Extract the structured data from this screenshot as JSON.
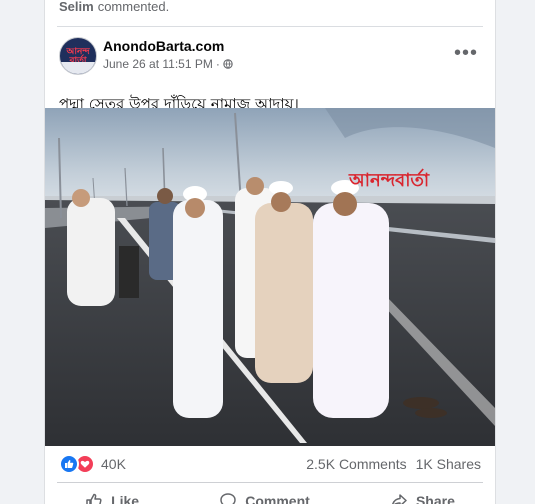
{
  "activity": {
    "actor": "Selim",
    "text": "commented."
  },
  "post": {
    "page_name": "AnondoBarta.com",
    "date": "June 26 at 11:51 PM",
    "separator": "·",
    "privacy_icon": "globe-icon",
    "more_icon": "more-horizontal-icon",
    "more_label": "•••",
    "text": "পদ্মা সেতুর উপর দাঁড়িয়ে নামাজ আদায়।",
    "avatar_text": "আনন্দ\nবার্তা",
    "photo": {
      "description": "Men in white clothing and caps praying on a bridge road",
      "watermark": "আনন্দবার্তা"
    }
  },
  "stats": {
    "reactions_count": "40K",
    "comments": "2.5K Comments",
    "shares": "1K Shares"
  },
  "actions": {
    "like": "Like",
    "comment": "Comment",
    "share": "Share"
  },
  "colors": {
    "like_blue": "#1877f2",
    "love_red": "#f33e58",
    "watermark_red": "#d9262f"
  }
}
